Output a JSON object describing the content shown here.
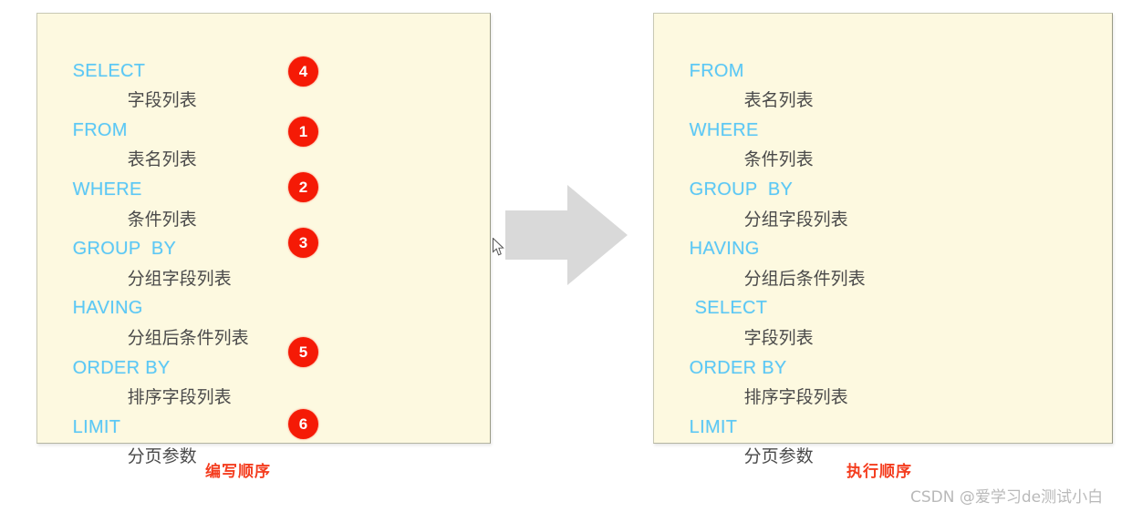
{
  "diagram": {
    "write_panel": {
      "caption": "编写顺序",
      "lines": [
        {
          "keyword": "SELECT",
          "value": "字段列表",
          "badge": "4"
        },
        {
          "keyword": "FROM",
          "value": "表名列表",
          "badge": "1"
        },
        {
          "keyword": "WHERE",
          "value": "条件列表",
          "badge": "2"
        },
        {
          "keyword": "GROUP  BY",
          "value": "分组字段列表",
          "badge": "3"
        },
        {
          "keyword": "HAVING",
          "value": "分组后条件列表",
          "badge": ""
        },
        {
          "keyword": "ORDER BY",
          "value": "排序字段列表",
          "badge": "5"
        },
        {
          "keyword": "LIMIT",
          "value": "分页参数",
          "badge": "6"
        }
      ]
    },
    "exec_panel": {
      "caption": "执行顺序",
      "lines": [
        {
          "keyword": "FROM",
          "value": "表名列表"
        },
        {
          "keyword": "WHERE",
          "value": "条件列表"
        },
        {
          "keyword": "GROUP  BY",
          "value": "分组字段列表"
        },
        {
          "keyword": "HAVING",
          "value": "分组后条件列表"
        },
        {
          "keyword": "SELECT",
          "value": "字段列表"
        },
        {
          "keyword": "ORDER BY",
          "value": "排序字段列表"
        },
        {
          "keyword": "LIMIT",
          "value": "分页参数"
        }
      ]
    },
    "arrow": {
      "direction": "right",
      "color": "#d9d9d9"
    },
    "badges": {
      "b1": "1",
      "b2": "2",
      "b3": "3",
      "b4": "4",
      "b5": "5",
      "b6": "6"
    }
  },
  "watermark": "CSDN @爱学习de测试小白",
  "colors": {
    "panel_background": "#fdf9e0",
    "keyword_blue": "#5bc8f5",
    "value_gray": "#4a4a4a",
    "badge_red": "#f51a06",
    "caption_red": "#f43c1e",
    "arrow_gray": "#d9d9d9",
    "watermark_gray": "#b9b9b9"
  }
}
